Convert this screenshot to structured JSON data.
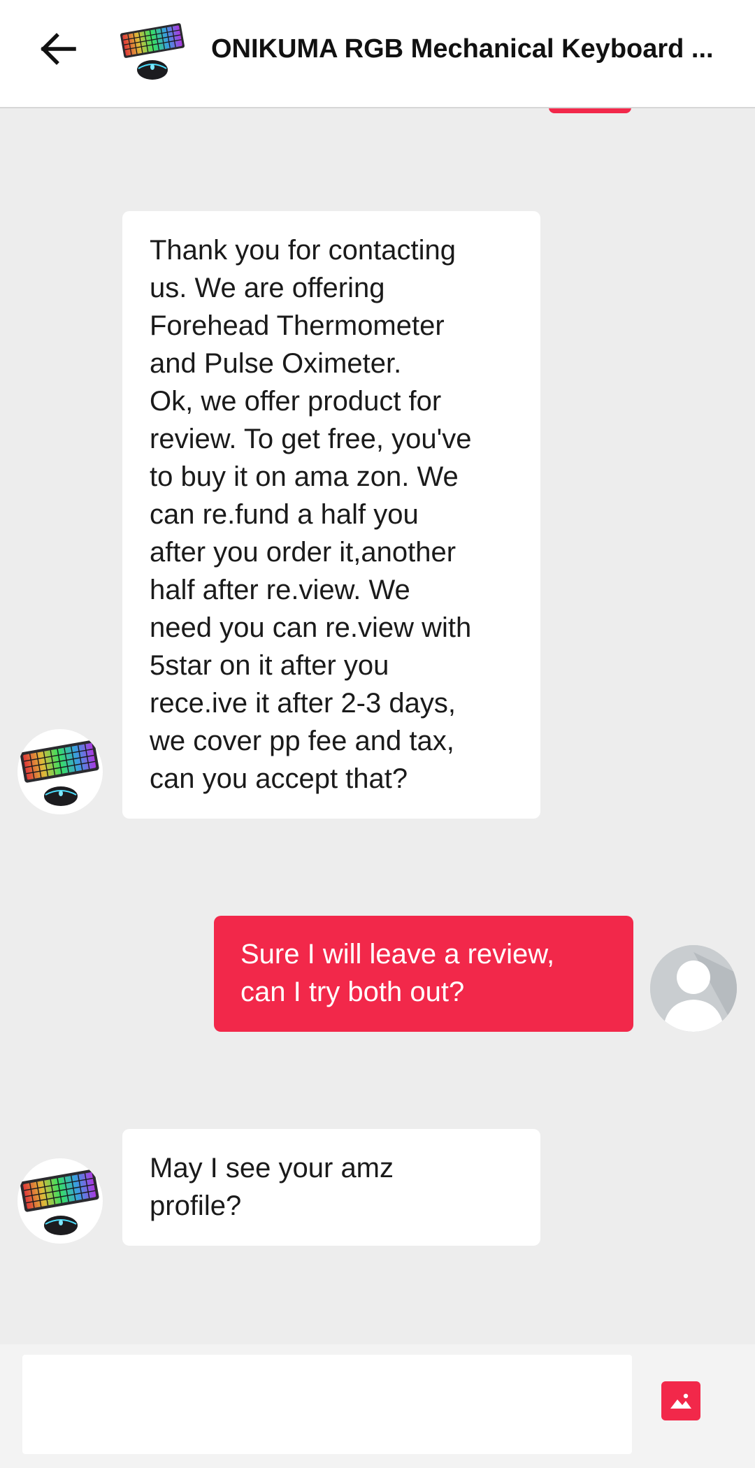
{
  "header": {
    "title": "ONIKUMA RGB Mechanical Keyboard ...",
    "back_icon": "arrow-left-icon",
    "thumb_icon": "keyboard-mouse-thumbnail"
  },
  "messages": [
    {
      "from": "seller",
      "lines": [
        "Thank you for contacting",
        "us. We are offering",
        "Forehead Thermometer",
        "and Pulse Oximeter.",
        "Ok, we offer product for",
        "review. To get free, you've",
        "to buy it on ama zon. We",
        "can re.fund a half you",
        "after you order it,another",
        "half after re.view. We",
        "need you can re.view with",
        "5star on it after you",
        "rece.ive it after 2-3 days,",
        "we cover pp fee and tax,",
        "can you accept that?"
      ]
    },
    {
      "from": "user",
      "lines": [
        "Sure I will leave a review,",
        "can I try both out?"
      ]
    },
    {
      "from": "seller",
      "lines": [
        "May I see your amz",
        "profile?"
      ]
    }
  ],
  "composer": {
    "placeholder": "",
    "image_icon": "image-icon"
  },
  "colors": {
    "accent": "#f2284a",
    "background": "#ededed",
    "bubble_incoming": "#ffffff",
    "header": "#ffffff"
  }
}
